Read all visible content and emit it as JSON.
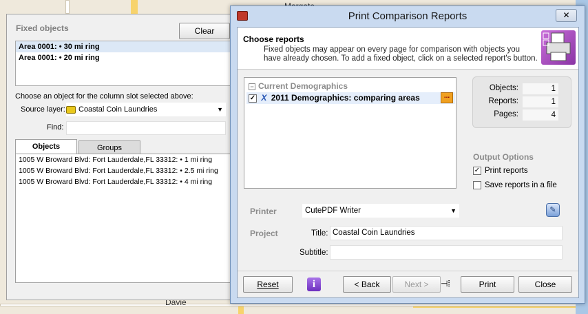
{
  "map": {
    "labels": [
      "Margate",
      "Davie"
    ]
  },
  "fixed_panel": {
    "title": "Fixed objects",
    "clear_label": "Clear",
    "fixed_items": [
      "Area 0001: • 30 mi ring",
      "Area 0001: • 20 mi ring"
    ],
    "choose_label": "Choose an object for the column slot selected above:",
    "source_layer_label": "Source layer:",
    "source_layer_value": "Coastal Coin Laundries",
    "find_label": "Find:",
    "find_value": "",
    "tabs": [
      "Objects",
      "Groups"
    ],
    "objects": [
      "1005 W Broward Blvd: Fort Lauderdale,FL 33312: • 1 mi ring",
      "1005 W Broward Blvd: Fort Lauderdale,FL 33312: • 2.5 mi ring",
      "1005 W Broward Blvd: Fort Lauderdale,FL 33312: • 4 mi ring"
    ]
  },
  "dialog": {
    "title": "Print Comparison Reports",
    "close_glyph": "✕",
    "header_title": "Choose reports",
    "header_desc": "Fixed objects may appear on every page for comparison with objects you have already chosen. To add a fixed object, click on a selected report's button.",
    "group_label": "Current Demographics",
    "report_label": "2011 Demographics: comparing areas",
    "report_checked": true,
    "more_glyph": "...",
    "stats": {
      "objects_label": "Objects:",
      "objects_value": "1",
      "reports_label": "Reports:",
      "reports_value": "1",
      "pages_label": "Pages:",
      "pages_value": "4"
    },
    "output_title": "Output Options",
    "print_reports_label": "Print reports",
    "print_reports_checked": true,
    "save_reports_label": "Save reports in a file",
    "save_reports_checked": false,
    "printer_label": "Printer",
    "printer_value": "CutePDF Writer",
    "project_label": "Project",
    "title_label": "Title:",
    "title_value": "Coastal Coin Laundries",
    "subtitle_label": "Subtitle:",
    "subtitle_value": "",
    "footer": {
      "reset": "Reset",
      "info_glyph": "i",
      "back": "< Back",
      "next": "Next >",
      "print": "Print",
      "close": "Close"
    }
  }
}
